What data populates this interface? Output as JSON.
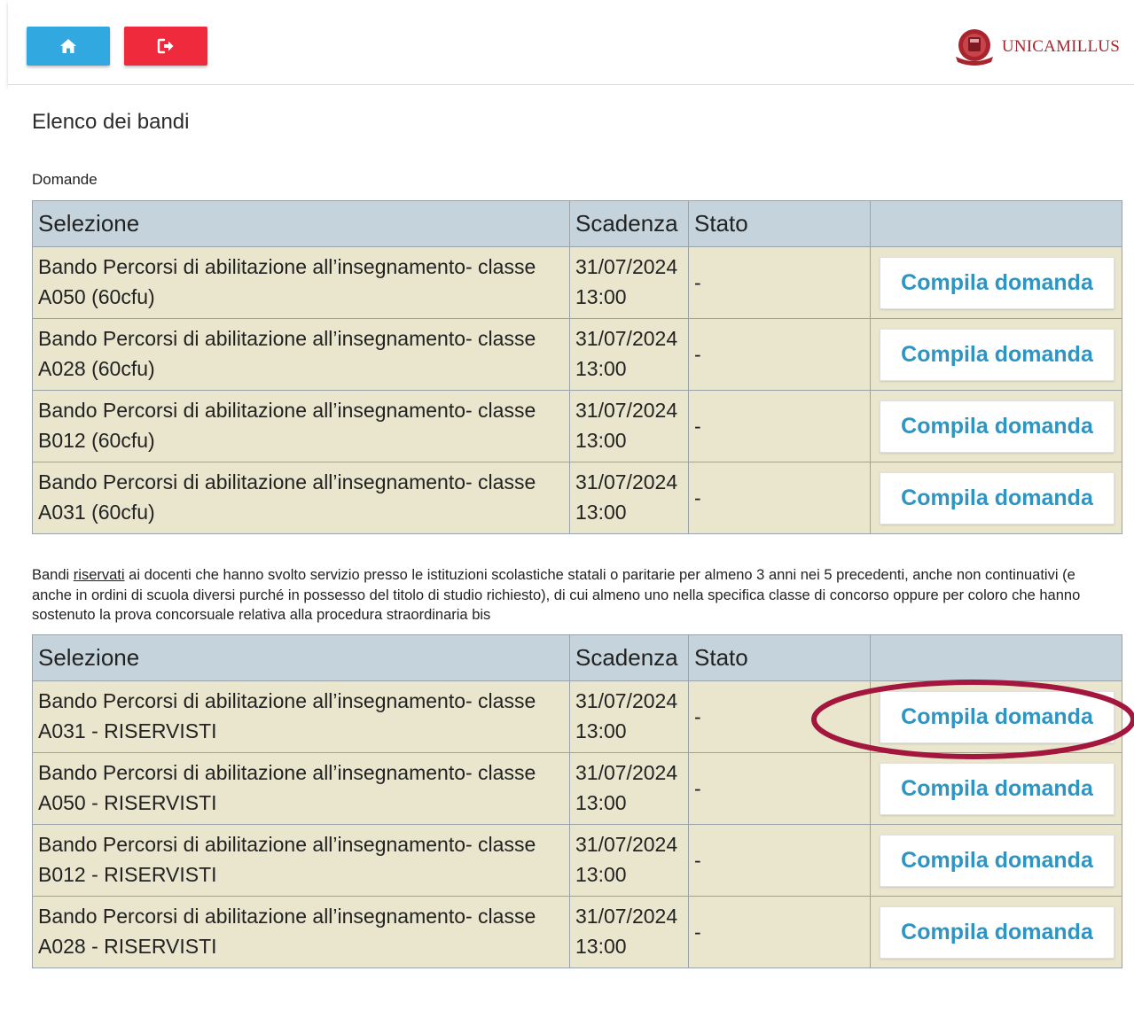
{
  "header": {
    "home_icon": "home-icon",
    "logout_icon": "logout-icon",
    "logo_text": "UNICAMILLUS",
    "home_color": "#31a8df",
    "logout_color": "#ee2a3c",
    "logo_color": "#a8252e"
  },
  "page": {
    "title": "Elenco dei bandi"
  },
  "section1": {
    "label": "Domande",
    "columns": [
      "Selezione",
      "Scadenza",
      "Stato",
      ""
    ],
    "rows": [
      {
        "sel_line1": "Bando Percorsi di abilitazione all’insegnamento- classe",
        "sel_line2": "A050 (60cfu)",
        "date": "31/07/2024",
        "time": "13:00",
        "stato": "-",
        "action": "Compila domanda"
      },
      {
        "sel_line1": "Bando Percorsi di abilitazione all’insegnamento- classe",
        "sel_line2": "A028 (60cfu)",
        "date": "31/07/2024",
        "time": "13:00",
        "stato": "-",
        "action": "Compila domanda"
      },
      {
        "sel_line1": "Bando Percorsi di abilitazione all’insegnamento- classe",
        "sel_line2": "B012 (60cfu)",
        "date": "31/07/2024",
        "time": "13:00",
        "stato": "-",
        "action": "Compila domanda"
      },
      {
        "sel_line1": "Bando Percorsi di abilitazione all’insegnamento- classe",
        "sel_line2": "A031 (60cfu)",
        "date": "31/07/2024",
        "time": "13:00",
        "stato": "-",
        "action": "Compila domanda"
      }
    ]
  },
  "section2": {
    "desc_before": "Bandi ",
    "desc_underlined": "riservati",
    "desc_after": " ai docenti che hanno svolto servizio presso le istituzioni scolastiche statali o paritarie per almeno 3 anni nei 5 precedenti, anche non continuativi (e anche in ordini di scuola diversi purché in possesso del titolo di studio richiesto), di cui almeno uno nella specifica classe di concorso oppure per coloro che hanno sostenuto la prova concorsuale relativa alla procedura straordinaria bis",
    "columns": [
      "Selezione",
      "Scadenza",
      "Stato",
      ""
    ],
    "rows": [
      {
        "sel_line1": "Bando Percorsi di abilitazione all’insegnamento- classe",
        "sel_line2": "A031 - RISERVISTI",
        "date": "31/07/2024",
        "time": "13:00",
        "stato": "-",
        "action": "Compila domanda"
      },
      {
        "sel_line1": "Bando Percorsi di abilitazione all’insegnamento- classe",
        "sel_line2": "A050 - RISERVISTI",
        "date": "31/07/2024",
        "time": "13:00",
        "stato": "-",
        "action": "Compila domanda"
      },
      {
        "sel_line1": "Bando Percorsi di abilitazione all’insegnamento- classe",
        "sel_line2": "B012 - RISERVISTI",
        "date": "31/07/2024",
        "time": "13:00",
        "stato": "-",
        "action": "Compila domanda"
      },
      {
        "sel_line1": "Bando Percorsi di abilitazione all’insegnamento- classe",
        "sel_line2": "A028 - RISERVISTI",
        "date": "31/07/2024",
        "time": "13:00",
        "stato": "-",
        "action": "Compila domanda"
      }
    ]
  },
  "annotation": {
    "shape": "ellipse",
    "color": "#a3173f",
    "target": "section2.rows.0.action"
  }
}
